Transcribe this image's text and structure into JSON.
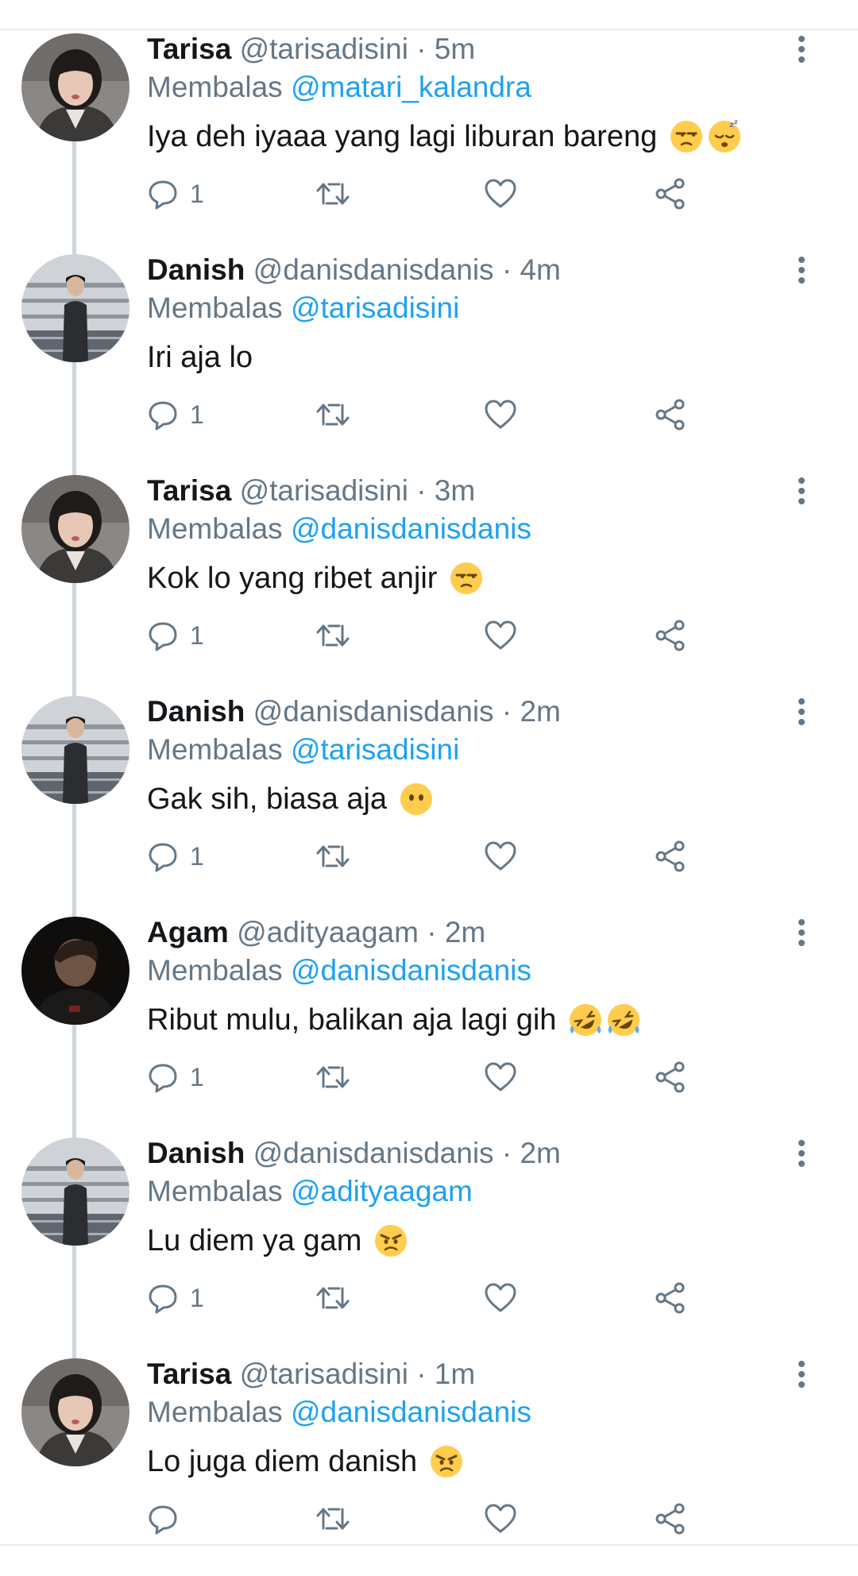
{
  "colors": {
    "name": "#14171a",
    "meta": "#657786",
    "mention": "#1da1f2",
    "thread_line": "#ccd6dd",
    "divider": "#e6ecf0"
  },
  "reply_prefix": "Membalas",
  "tweets": [
    {
      "name": "Tarisa",
      "handle": "@tarisadisini",
      "time": "· 5m",
      "reply_to": "@matari_kalandra",
      "text": "Iya deh iyaaa yang lagi liburan bareng",
      "emojis": [
        "unamused-emoji",
        "sleeping-emoji"
      ],
      "reply_count": "1"
    },
    {
      "name": "Danish",
      "handle": "@danisdanisdanis",
      "time": "· 4m",
      "reply_to": "@tarisadisini",
      "text": "Iri aja lo",
      "emojis": [],
      "reply_count": "1"
    },
    {
      "name": "Tarisa",
      "handle": "@tarisadisini",
      "time": "· 3m",
      "reply_to": "@danisdanisdanis",
      "text": "Kok lo yang ribet anjir",
      "emojis": [
        "unamused-emoji"
      ],
      "reply_count": "1"
    },
    {
      "name": "Danish",
      "handle": "@danisdanisdanis",
      "time": "· 2m",
      "reply_to": "@tarisadisini",
      "text": "Gak sih, biasa aja",
      "emojis": [
        "no-mouth-emoji"
      ],
      "reply_count": "1"
    },
    {
      "name": "Agam",
      "handle": "@adityaagam",
      "time": "· 2m",
      "reply_to": "@danisdanisdanis",
      "text": "Ribut mulu, balikan aja lagi gih",
      "emojis": [
        "rofl-emoji",
        "rofl-emoji"
      ],
      "reply_count": "1"
    },
    {
      "name": "Danish",
      "handle": "@danisdanisdanis",
      "time": "· 2m",
      "reply_to": "@adityaagam",
      "text": "Lu diem ya gam",
      "emojis": [
        "angry-emoji"
      ],
      "reply_count": "1"
    },
    {
      "name": "Tarisa",
      "handle": "@tarisadisini",
      "time": "· 1m",
      "reply_to": "@danisdanisdanis",
      "text": "Lo juga diem danish",
      "emojis": [
        "angry-emoji"
      ],
      "reply_count": ""
    }
  ]
}
